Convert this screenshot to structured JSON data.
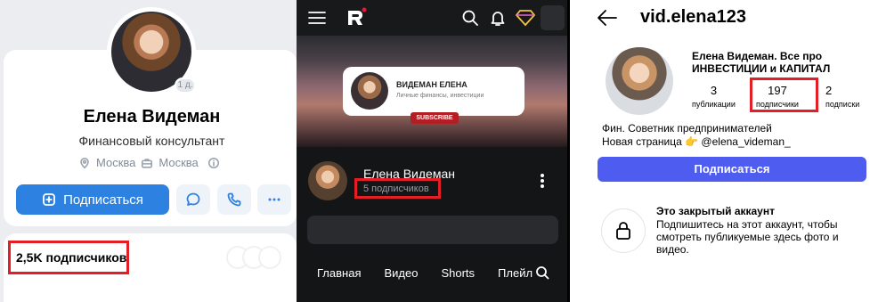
{
  "vk": {
    "online_badge": "1 д.",
    "name": "Елена Видеман",
    "status": "Финансовый консультант",
    "location_city": "Москва",
    "work_city": "Москва",
    "subscribe_label": "Подписаться",
    "followers": "2,5K подписчиков",
    "accent": "#2d81e0"
  },
  "rutube": {
    "banner_title": "ВИДЕМАН ЕЛЕНА",
    "banner_subtitle": "Личные финансы, инвестиции",
    "banner_subscribe": "SUBSCRIBE",
    "channel_name": "Елена Видеман",
    "channel_subs": "5 подписчиков",
    "tabs": [
      "Главная",
      "Видео",
      "Shorts",
      "Плейл"
    ]
  },
  "instagram": {
    "handle": "vid.elena123",
    "title_line1": "Елена Видеман. Все про",
    "title_line2": "ИНВЕСТИЦИИ и КАПИТАЛ",
    "stats": [
      {
        "n": "3",
        "l": "публикации"
      },
      {
        "n": "197",
        "l": "подписчики"
      },
      {
        "n": "2",
        "l": "подписки"
      }
    ],
    "bio_line1": "Фин. Советник предпринимателей",
    "bio_line2": "Новая страница 👉 @elena_videman_",
    "subscribe_label": "Подписаться",
    "private_title": "Это закрытый аккаунт",
    "private_desc": "Подпишитесь на этот аккаунт, чтобы смотреть публикуемые здесь фото и видео.",
    "accent": "#4e5cf0"
  }
}
